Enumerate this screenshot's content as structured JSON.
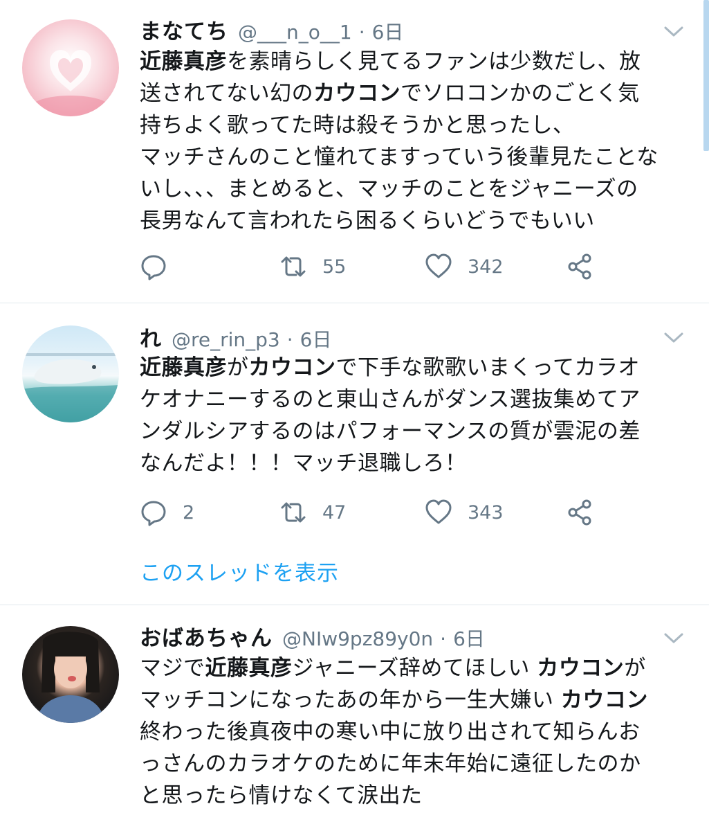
{
  "tweets": [
    {
      "name": "まなてち",
      "handle": "@___n_o__1",
      "time": "6日",
      "lines": [
        [
          {
            "t": "近藤真彦",
            "b": true
          },
          {
            "t": "を素晴らしく見てるファンは少数だし、放"
          }
        ],
        [
          {
            "t": "送されてない幻の"
          },
          {
            "t": "カウコン",
            "b": true
          },
          {
            "t": "でソロコンかのごとく気"
          }
        ],
        [
          {
            "t": "持ちよく歌ってた時は殺そうかと思ったし、"
          }
        ],
        [
          {
            "t": "マッチさんのこと憧れてますっていう後輩見たことな"
          }
        ],
        [
          {
            "t": "いし、、、まとめると、マッチのことをジャニーズの"
          }
        ],
        [
          {
            "t": "長男なんて言われたら困るくらいどうでもいい"
          }
        ]
      ],
      "reply_count": "",
      "retweet_count": "55",
      "like_count": "342"
    },
    {
      "name": "れ",
      "handle": "@re_rin_p3",
      "time": "6日",
      "lines": [
        [
          {
            "t": "近藤真彦",
            "b": true
          },
          {
            "t": "が"
          },
          {
            "t": "カウコン",
            "b": true
          },
          {
            "t": "で下手な歌歌いまくってカラオ"
          }
        ],
        [
          {
            "t": "ケオナニーするのと東山さんがダンス選抜集めてア"
          }
        ],
        [
          {
            "t": "ンダルシアするのはパフォーマンスの質が雲泥の差"
          }
        ],
        [
          {
            "t": "なんだよ！！！マッチ退職しろ！"
          }
        ]
      ],
      "reply_count": "2",
      "retweet_count": "47",
      "like_count": "343",
      "thread_link": "このスレッドを表示"
    },
    {
      "name": "おばあちゃん",
      "handle": "@NIw9pz89y0n",
      "time": "6日",
      "lines": [
        [
          {
            "t": "マジで"
          },
          {
            "t": "近藤真彦",
            "b": true
          },
          {
            "t": "ジャニーズ辞めてほしい "
          },
          {
            "t": "カウコン",
            "b": true
          },
          {
            "t": "が"
          }
        ],
        [
          {
            "t": "マッチコンになったあの年から一生大嫌い "
          },
          {
            "t": "カウコン",
            "b": true
          }
        ],
        [
          {
            "t": "終わった後真夜中の寒い中に放り出されて知らんお"
          }
        ],
        [
          {
            "t": "っさんのカラオケのために年末年始に遠征したのか"
          }
        ],
        [
          {
            "t": "と思ったら情けなくて涙出た"
          }
        ]
      ]
    }
  ],
  "separator": "·",
  "icons": {
    "reply": "reply-icon",
    "retweet": "retweet-icon",
    "like": "heart-icon",
    "share": "share-icon",
    "menu": "chevron-down-icon"
  },
  "colors": {
    "text": "#14171a",
    "muted": "#657786",
    "link": "#1da1f2",
    "divider": "#e1e8ed"
  }
}
